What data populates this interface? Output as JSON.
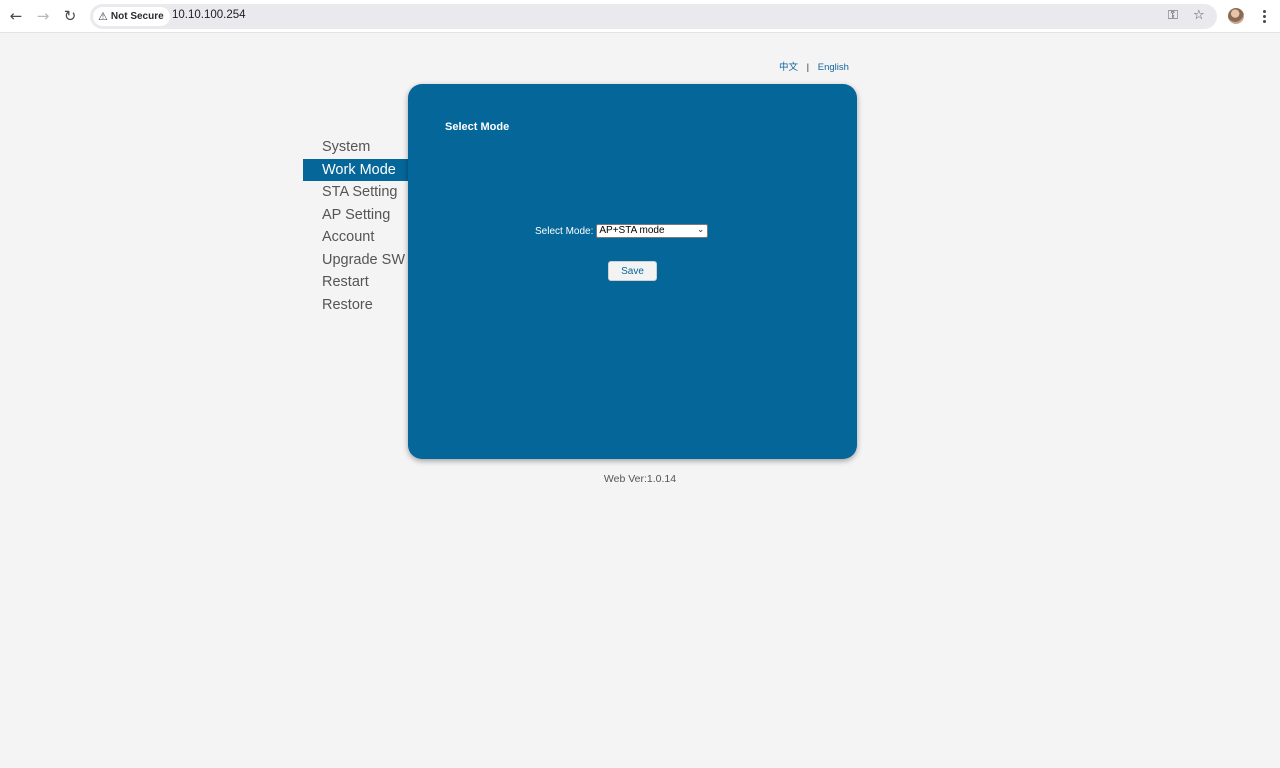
{
  "browser": {
    "security_label": "Not Secure",
    "url": "10.10.100.254"
  },
  "lang": {
    "chinese": "中文",
    "separator": "|",
    "english": "English"
  },
  "menu": {
    "items": [
      {
        "label": "System"
      },
      {
        "label": "Work Mode",
        "active": true
      },
      {
        "label": "STA Setting"
      },
      {
        "label": "AP Setting"
      },
      {
        "label": "Account"
      },
      {
        "label": "Upgrade SW"
      },
      {
        "label": "Restart"
      },
      {
        "label": "Restore"
      }
    ]
  },
  "panel": {
    "title": "Select Mode",
    "mode_label": "Select Mode:",
    "mode_value": "AP+STA mode",
    "save_label": "Save"
  },
  "footer": {
    "version": "Web Ver:1.0.14"
  },
  "colors": {
    "accent": "#05669a",
    "background": "#f4f4f4"
  }
}
